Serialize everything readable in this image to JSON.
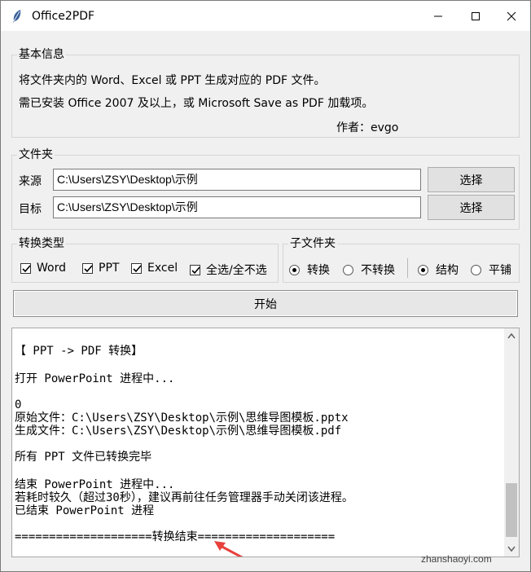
{
  "window": {
    "title": "Office2PDF"
  },
  "info": {
    "legend": "基本信息",
    "line1": "将文件夹内的 Word、Excel 或 PPT 生成对应的 PDF 文件。",
    "line2": "需已安装 Office 2007 及以上，或 Microsoft Save as PDF 加载项。",
    "author": "作者：evgo"
  },
  "folder": {
    "legend": "文件夹",
    "source_label": "来源",
    "source_value": "C:\\Users\\ZSY\\Desktop\\示例",
    "target_label": "目标",
    "target_value": "C:\\Users\\ZSY\\Desktop\\示例",
    "browse_label": "选择"
  },
  "convert_type": {
    "legend": "转换类型",
    "options": [
      {
        "label": "Word",
        "checked": true
      },
      {
        "label": "PPT",
        "checked": true
      },
      {
        "label": "Excel",
        "checked": true
      },
      {
        "label": "全选/全不选",
        "checked": true
      }
    ]
  },
  "subfolder": {
    "legend": "子文件夹",
    "convert_options": [
      {
        "label": "转换",
        "selected": true
      },
      {
        "label": "不转换",
        "selected": false
      }
    ],
    "layout_options": [
      {
        "label": "结构",
        "selected": true
      },
      {
        "label": "平铺",
        "selected": false
      }
    ]
  },
  "start_label": "开始",
  "log": {
    "lines": [
      "【 PPT -> PDF 转换】",
      "",
      "打开 PowerPoint 进程中...",
      "",
      "0",
      "原始文件：C:\\Users\\ZSY\\Desktop\\示例\\思维导图模板.pptx",
      "生成文件：C:\\Users\\ZSY\\Desktop\\示例\\思维导图模板.pdf",
      "",
      "所有 PPT 文件已转换完毕",
      "",
      "结束 PowerPoint 进程中...",
      "若耗时较久（超过30秒），建议再前往任务管理器手动关闭该进程。",
      "已结束 PowerPoint 进程",
      "",
      "====================转换结束===================="
    ]
  },
  "watermark": "zhanshaoyi.com",
  "colors": {
    "arrow": "#e8413c",
    "titlebar": "#ffffff",
    "window_bg": "#f0f0f0"
  }
}
